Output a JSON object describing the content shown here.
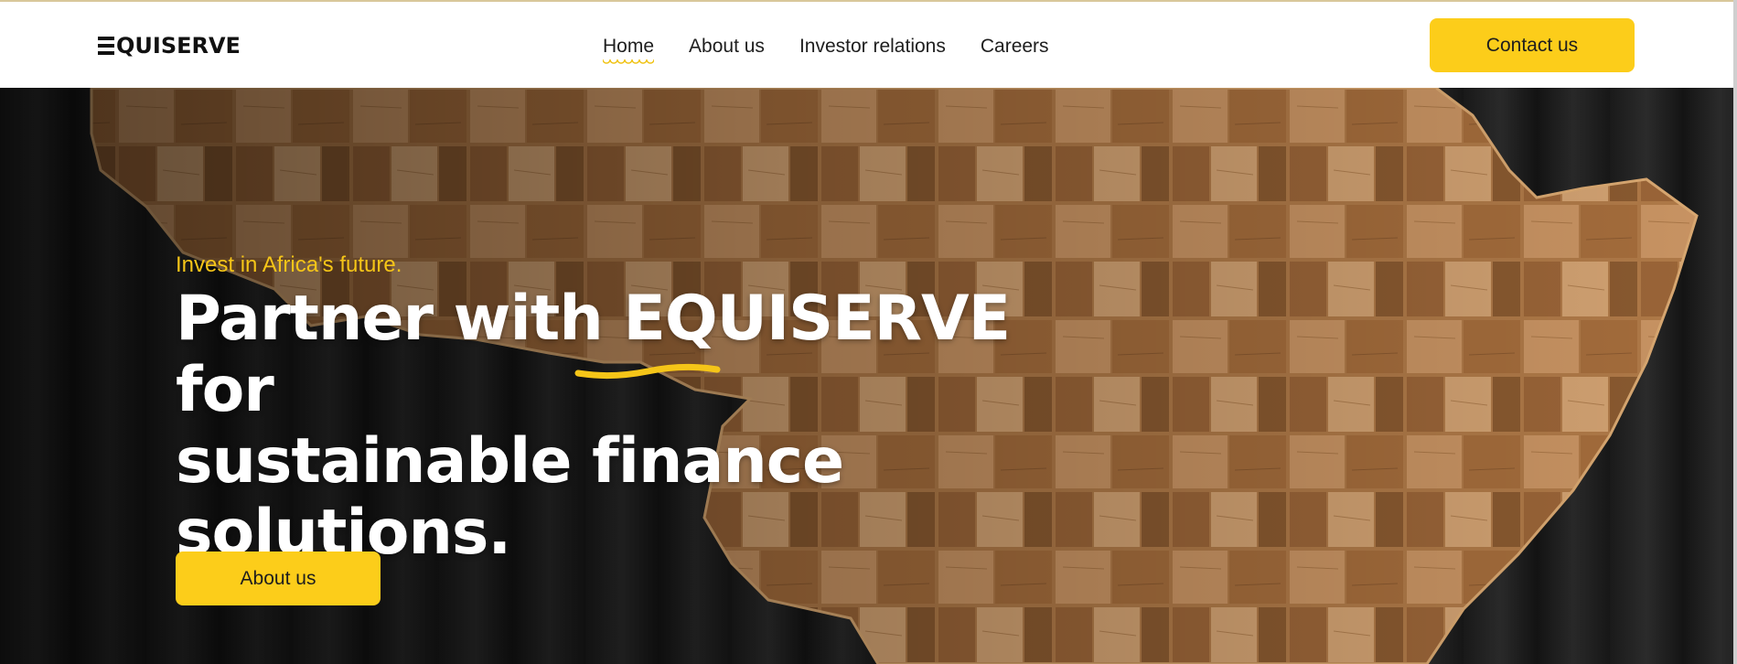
{
  "header": {
    "logo_text": "QUISERVE",
    "nav": [
      {
        "label": "Home",
        "active": true
      },
      {
        "label": "About us",
        "active": false
      },
      {
        "label": "Investor relations",
        "active": false
      },
      {
        "label": "Careers",
        "active": false
      }
    ],
    "contact_label": "Contact us"
  },
  "hero": {
    "tagline": "Invest in Africa's future.",
    "headline_pre": "Partner with ",
    "headline_brand": "EQUISERVE",
    "headline_post_line1": " for",
    "headline_line2": "sustainable finance solutions.",
    "cta_label": "About us",
    "background_description": "wooden map of Africa on dark corrugated wall"
  },
  "colors": {
    "accent": "#fccd1a",
    "tagline": "#f5c518",
    "text_dark": "#1e1e1e",
    "hero_text": "#ffffff"
  }
}
